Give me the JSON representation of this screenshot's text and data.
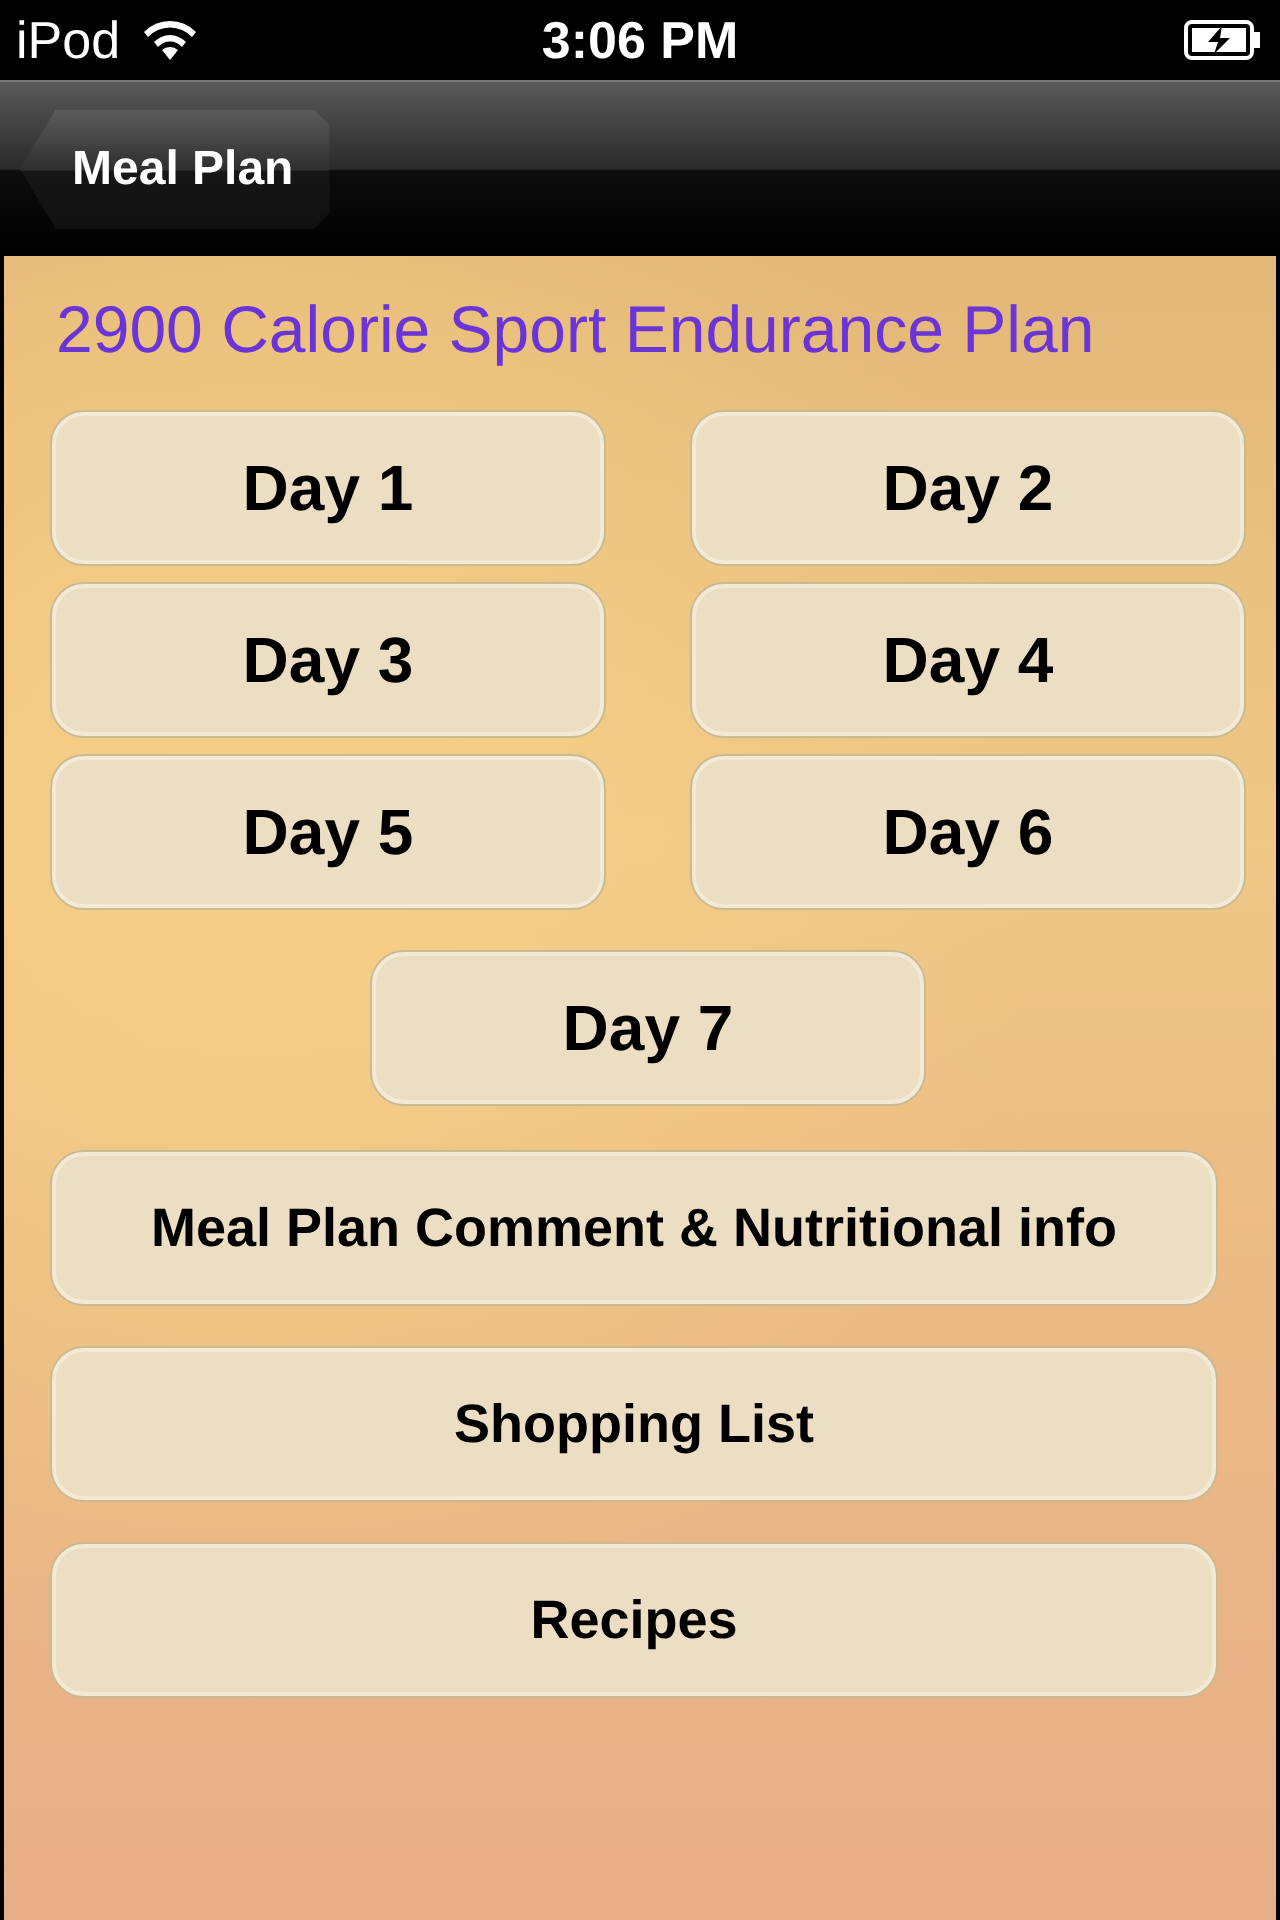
{
  "status_bar": {
    "carrier": "iPod",
    "time": "3:06 PM"
  },
  "nav_bar": {
    "back_button": "Meal Plan"
  },
  "title": "2900 Calorie Sport Endurance Plan",
  "days": [
    "Day 1",
    "Day 2",
    "Day 3",
    "Day 4",
    "Day 5",
    "Day 6",
    "Day 7"
  ],
  "actions": [
    "Meal Plan Comment & Nutritional info",
    "Shopping List",
    "Recipes"
  ]
}
